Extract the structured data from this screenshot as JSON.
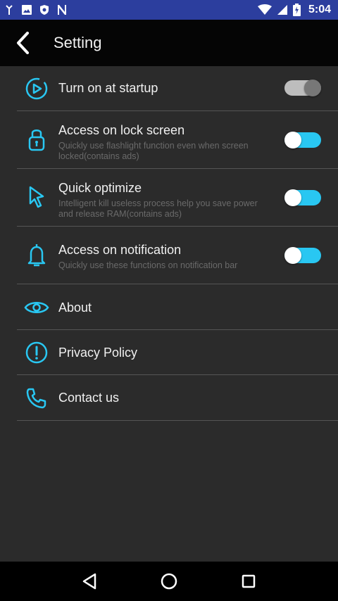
{
  "status_bar": {
    "time": "5:04",
    "icons": [
      "signal-tower-icon",
      "image-icon",
      "shield-icon",
      "n-notification-icon",
      "wifi-icon",
      "cellular-icon",
      "battery-charging-icon"
    ]
  },
  "header": {
    "title": "Setting",
    "back_icon": "back-arrow-icon"
  },
  "settings": [
    {
      "id": "startup",
      "icon": "play-clock-icon",
      "label": "Turn on at startup",
      "description": "",
      "toggle": "off"
    },
    {
      "id": "lock-screen",
      "icon": "lock-icon",
      "label": "Access on lock screen",
      "description": "Quickly use flashlight function even when screen locked(contains ads)",
      "toggle": "on"
    },
    {
      "id": "quick-optimize",
      "icon": "cursor-icon",
      "label": "Quick optimize",
      "description": "Intelligent kill useless process help you save power and release RAM(contains ads)",
      "toggle": "on"
    },
    {
      "id": "notification",
      "icon": "bell-icon",
      "label": "Access on notification",
      "description": "Quickly use these functions on notification bar",
      "toggle": "on"
    },
    {
      "id": "about",
      "icon": "eye-icon",
      "label": "About"
    },
    {
      "id": "privacy",
      "icon": "exclamation-circle-icon",
      "label": "Privacy Policy"
    },
    {
      "id": "contact",
      "icon": "phone-icon",
      "label": "Contact us"
    }
  ],
  "colors": {
    "accent": "#29c7f2",
    "background": "#2b2b2b",
    "appbar": "#050505",
    "statusbar": "#2c3e9e"
  },
  "nav_bar": {
    "buttons": [
      "back-triangle-icon",
      "home-circle-icon",
      "recents-square-icon"
    ]
  }
}
